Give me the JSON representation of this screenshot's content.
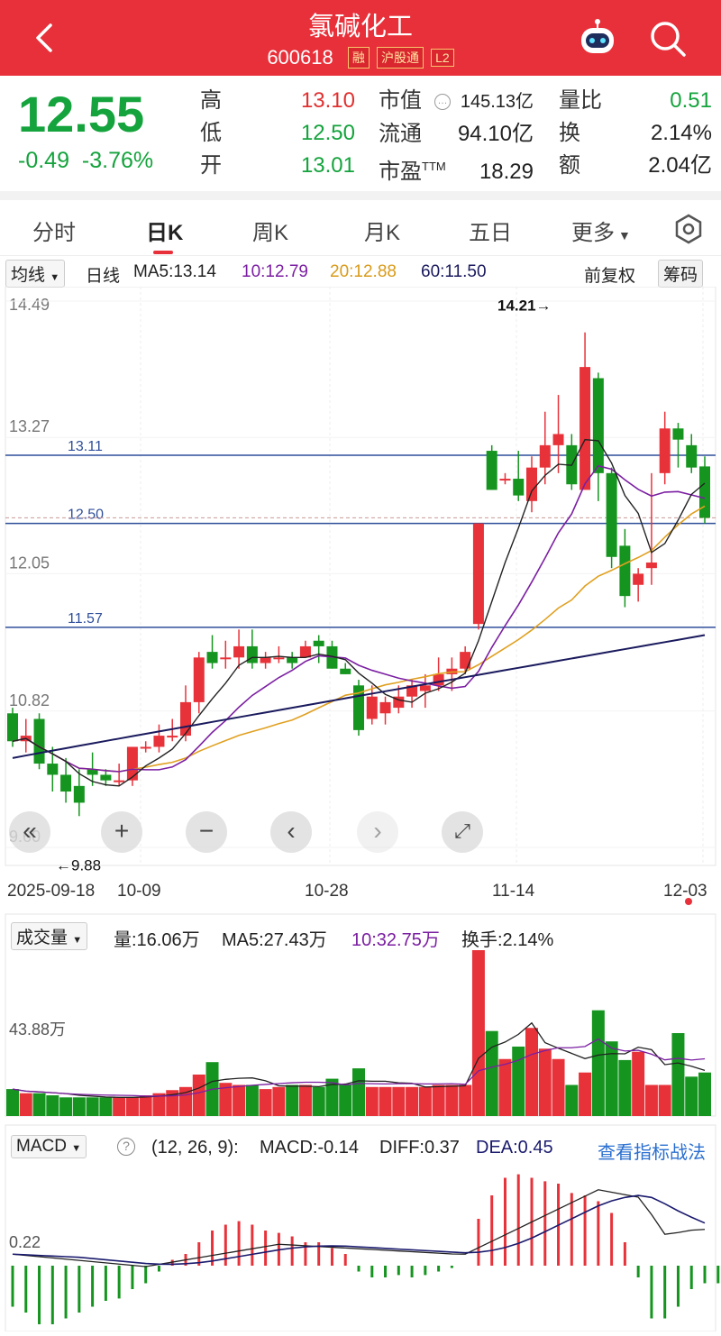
{
  "header": {
    "title": "氯碱化工",
    "code": "600618",
    "tags": [
      "融",
      "沪股通",
      "L2"
    ]
  },
  "quote": {
    "price": "12.55",
    "change": "-0.49",
    "change_pct": "-3.76%",
    "high_label": "高",
    "high": "13.10",
    "low_label": "低",
    "low": "12.50",
    "open_label": "开",
    "open": "13.01",
    "mktcap_label": "市值",
    "mktcap": "145.13亿",
    "float_label": "流通",
    "float": "94.10亿",
    "pe_label": "市盈",
    "pe_suffix": "TTM",
    "pe": "18.29",
    "volratio_label": "量比",
    "volratio": "0.51",
    "turnover_label": "换",
    "turnover": "2.14%",
    "amount_label": "额",
    "amount": "2.04亿"
  },
  "tabs": [
    "分时",
    "日K",
    "周K",
    "月K",
    "五日",
    "更多"
  ],
  "ma_row": {
    "selector": "均线",
    "period": "日线",
    "ma5": "MA5:13.14",
    "ma10": "10:12.79",
    "ma20": "20:12.88",
    "ma60": "60:11.50",
    "adjust": "前复权",
    "chips": "筹码"
  },
  "kline": {
    "y_ticks": [
      "14.49",
      "13.27",
      "12.05",
      "10.82",
      "9.60"
    ],
    "hlines": [
      "13.11",
      "12.50",
      "11.57"
    ],
    "max_label": "14.21→",
    "min_label": "←9.88",
    "dates": [
      "2025-09-18",
      "10-09",
      "10-28",
      "11-14",
      "12-03"
    ],
    "candles": [
      [
        10.8,
        10.85,
        10.5,
        10.55
      ],
      [
        10.55,
        10.75,
        10.45,
        10.6
      ],
      [
        10.75,
        10.8,
        10.3,
        10.35
      ],
      [
        10.35,
        10.5,
        10.1,
        10.25
      ],
      [
        10.25,
        10.4,
        10.0,
        10.1
      ],
      [
        10.15,
        10.3,
        9.88,
        10.0
      ],
      [
        10.3,
        10.45,
        10.15,
        10.25
      ],
      [
        10.25,
        10.3,
        10.15,
        10.2
      ],
      [
        10.2,
        10.35,
        10.15,
        10.2
      ],
      [
        10.2,
        10.5,
        10.15,
        10.5
      ],
      [
        10.5,
        10.55,
        10.45,
        10.5
      ],
      [
        10.5,
        10.7,
        10.45,
        10.6
      ],
      [
        10.6,
        10.75,
        10.55,
        10.6
      ],
      [
        10.6,
        11.05,
        10.55,
        10.9
      ],
      [
        10.9,
        11.35,
        10.8,
        11.3
      ],
      [
        11.35,
        11.5,
        11.2,
        11.25
      ],
      [
        11.3,
        11.45,
        11.2,
        11.3
      ],
      [
        11.3,
        11.55,
        11.2,
        11.4
      ],
      [
        11.4,
        11.55,
        11.2,
        11.25
      ],
      [
        11.25,
        11.35,
        11.2,
        11.3
      ],
      [
        11.3,
        11.4,
        11.25,
        11.3
      ],
      [
        11.3,
        11.35,
        11.2,
        11.25
      ],
      [
        11.3,
        11.45,
        11.3,
        11.4
      ],
      [
        11.45,
        11.5,
        11.25,
        11.4
      ],
      [
        11.4,
        11.45,
        11.2,
        11.2
      ],
      [
        11.2,
        11.25,
        11.15,
        11.15
      ],
      [
        11.05,
        11.1,
        10.6,
        10.65
      ],
      [
        10.75,
        11.05,
        10.7,
        10.95
      ],
      [
        10.8,
        10.95,
        10.7,
        10.9
      ],
      [
        10.85,
        11.05,
        10.8,
        10.95
      ],
      [
        10.95,
        11.1,
        10.85,
        11.05
      ],
      [
        11.0,
        11.15,
        10.85,
        11.05
      ],
      [
        11.05,
        11.3,
        11.0,
        11.15
      ],
      [
        11.15,
        11.3,
        11.0,
        11.2
      ],
      [
        11.2,
        11.4,
        11.15,
        11.35
      ],
      [
        11.6,
        12.5,
        11.55,
        12.5
      ],
      [
        13.15,
        13.2,
        12.8,
        12.8
      ],
      [
        12.9,
        12.95,
        12.85,
        12.9
      ],
      [
        12.9,
        13.15,
        12.7,
        12.75
      ],
      [
        12.7,
        13.1,
        12.6,
        13.0
      ],
      [
        13.0,
        13.5,
        12.85,
        13.2
      ],
      [
        13.2,
        13.65,
        12.95,
        13.3
      ],
      [
        13.2,
        13.3,
        12.8,
        12.85
      ],
      [
        12.8,
        14.21,
        12.85,
        13.9
      ],
      [
        13.8,
        13.85,
        12.7,
        12.95
      ],
      [
        12.95,
        13.0,
        12.1,
        12.2
      ],
      [
        12.3,
        12.45,
        11.75,
        11.85
      ],
      [
        11.95,
        12.1,
        11.8,
        12.05
      ],
      [
        12.1,
        12.95,
        11.95,
        12.15
      ],
      [
        12.95,
        13.5,
        12.85,
        13.35
      ],
      [
        13.35,
        13.4,
        13.0,
        13.25
      ],
      [
        13.2,
        13.3,
        12.95,
        13.0
      ],
      [
        13.01,
        13.1,
        12.5,
        12.55
      ]
    ]
  },
  "volume_row": {
    "selector": "成交量",
    "vol": "量:16.06万",
    "ma5": "MA5:27.43万",
    "ma10": "10:32.75万",
    "turnover": "换手:2.14%",
    "y_tick": "43.88万"
  },
  "macd_row": {
    "selector": "MACD",
    "help": "?",
    "params": "(12, 26, 9):",
    "macd": "MACD:-0.14",
    "diff": "DIFF:0.37",
    "dea": "DEA:0.45",
    "link": "查看指标战法",
    "y_tick": "0.22"
  },
  "colors": {
    "up": "#e8323a",
    "down": "#15951f",
    "accent": "#e8303a",
    "ma10": "#7b1fa2",
    "ma20": "#e0a020",
    "ma60": "#1a1a5e",
    "link": "#2a6fd0"
  }
}
